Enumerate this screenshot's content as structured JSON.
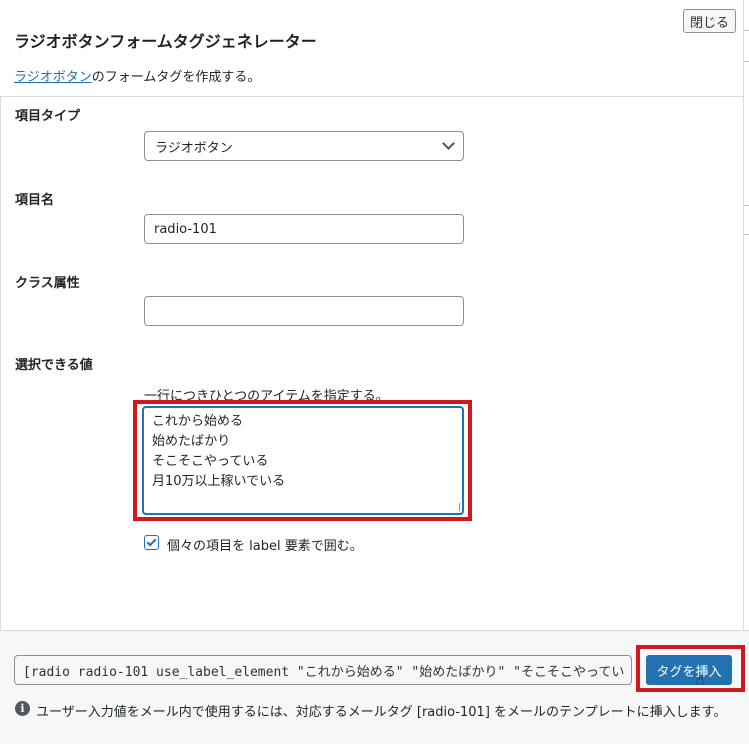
{
  "dialog": {
    "title": "ラジオボタンフォームタグジェネレーター",
    "close_label": "閉じる",
    "desc_link": "ラジオボタン",
    "desc_rest": "のフォームタグを作成する。"
  },
  "fields": {
    "type_label": "項目タイプ",
    "type_value": "ラジオボタン",
    "name_label": "項目名",
    "name_value": "radio-101",
    "class_label": "クラス属性",
    "class_value": "",
    "values_label": "選択できる値",
    "values_hint": "一行につきひとつのアイテムを指定する。",
    "values_lines": [
      "これから始める",
      "始めたばかり",
      "そこそこやっている",
      "月10万以上稼いでいる"
    ],
    "use_label_checked": true,
    "use_label_text": "個々の項目を label 要素で囲む。"
  },
  "footer": {
    "tag_text": "[radio radio-101 use_label_element \"これから始める\" \"始めたばかり\" \"そこそこやってい",
    "insert_label": "タグを挿入",
    "info_text": "ユーザー入力値をメール内で使用するには、対応するメールタグ [radio-101] をメールのテンプレートに挿入します。"
  },
  "colors": {
    "accent": "#2271b1",
    "highlight": "#d0181f"
  }
}
